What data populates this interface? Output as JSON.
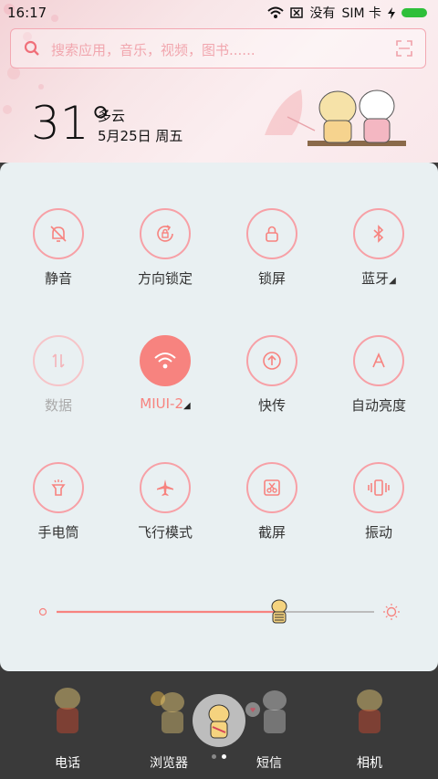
{
  "status": {
    "time": "16:17",
    "no_service": "没有",
    "sim": "SIM 卡"
  },
  "search": {
    "placeholder": "搜索应用，音乐，视频，图书......"
  },
  "weather": {
    "temperature": "31°",
    "condition": "多云",
    "date": "5月25日 周五"
  },
  "toggles": [
    {
      "label": "静音",
      "icon": "bell-off-icon"
    },
    {
      "label": "方向锁定",
      "icon": "rotation-lock-icon"
    },
    {
      "label": "锁屏",
      "icon": "lock-icon"
    },
    {
      "label": "蓝牙",
      "icon": "bluetooth-icon"
    },
    {
      "label": "数据",
      "icon": "data-arrows-icon"
    },
    {
      "label": "MIUI-2",
      "icon": "wifi-icon"
    },
    {
      "label": "快传",
      "icon": "upload-icon"
    },
    {
      "label": "自动亮度",
      "icon": "auto-brightness-icon"
    },
    {
      "label": "手电筒",
      "icon": "flashlight-icon"
    },
    {
      "label": "飞行模式",
      "icon": "airplane-icon"
    },
    {
      "label": "截屏",
      "icon": "screenshot-scissors-icon"
    },
    {
      "label": "振动",
      "icon": "vibrate-icon"
    }
  ],
  "brightness": {
    "level": 0.7
  },
  "dock": [
    {
      "label": "电话"
    },
    {
      "label": "浏览器"
    },
    {
      "label": "短信"
    },
    {
      "label": "相机"
    }
  ],
  "colors": {
    "accent": "#f7837f",
    "panel": "#e9f0f2",
    "outline": "#f7a0a6"
  }
}
